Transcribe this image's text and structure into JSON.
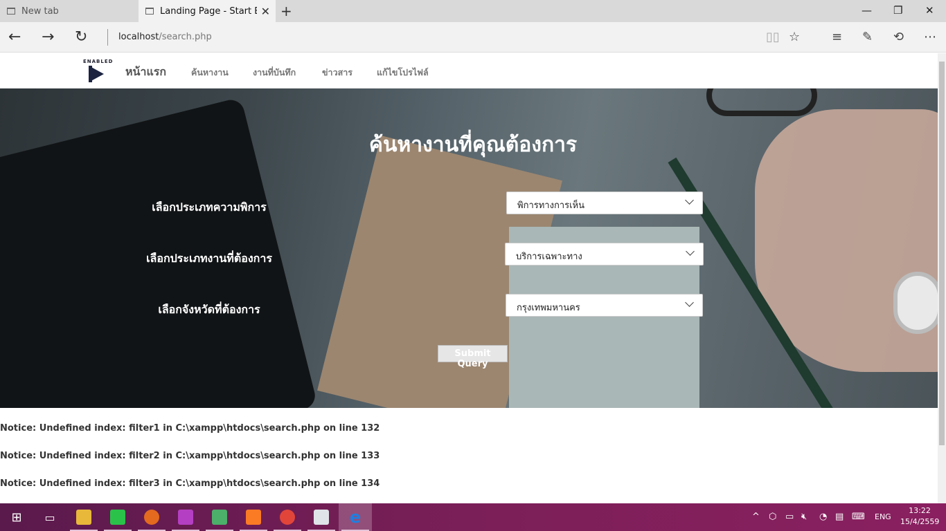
{
  "browser": {
    "tabs": [
      {
        "title": "New tab"
      },
      {
        "title": "Landing Page - Start Bootstrap"
      }
    ],
    "new_tab_glyph": "+",
    "address": {
      "host": "localhost",
      "path": "/search.php"
    }
  },
  "site_nav": {
    "logo_text": "ENABLED",
    "brand": "หน้าแรก",
    "links": [
      "ค้นหางาน",
      "งานที่บันทึก",
      "ข่าวสาร",
      "แก้ไขโปรไฟล์"
    ]
  },
  "hero": {
    "title": "ค้นหางานที่คุณต้องการ",
    "fields": [
      {
        "label": "เลือกประเภทความพิการ",
        "value": "พิการทางการเห็น"
      },
      {
        "label": "เลือกประเภทงานที่ต้องการ",
        "value": "บริการเฉพาะทาง"
      },
      {
        "label": "เลือกจังหวัดที่ต้องการ",
        "value": "กรุงเทพมหานคร"
      }
    ],
    "submit_label": "Submit Query"
  },
  "notices": [
    "Notice: Undefined index: filter1 in C:\\xampp\\htdocs\\search.php on line 132",
    "Notice: Undefined index: filter2 in C:\\xampp\\htdocs\\search.php on line 133",
    "Notice: Undefined index: filter3 in C:\\xampp\\htdocs\\search.php on line 134"
  ],
  "taskbar": {
    "language": "ENG",
    "time": "13:22",
    "date": "15/4/2559",
    "apps": [
      "start-icon",
      "task-view-icon",
      "file-explorer-icon",
      "line-icon",
      "firefox-icon",
      "phpstorm-icon",
      "android-icon",
      "xampp-icon",
      "chrome-icon",
      "news-icon",
      "edge-icon"
    ]
  },
  "colors": {
    "hero_text": "#ffffff",
    "taskbar": "#7b1f58",
    "nav_text": "#777777"
  }
}
